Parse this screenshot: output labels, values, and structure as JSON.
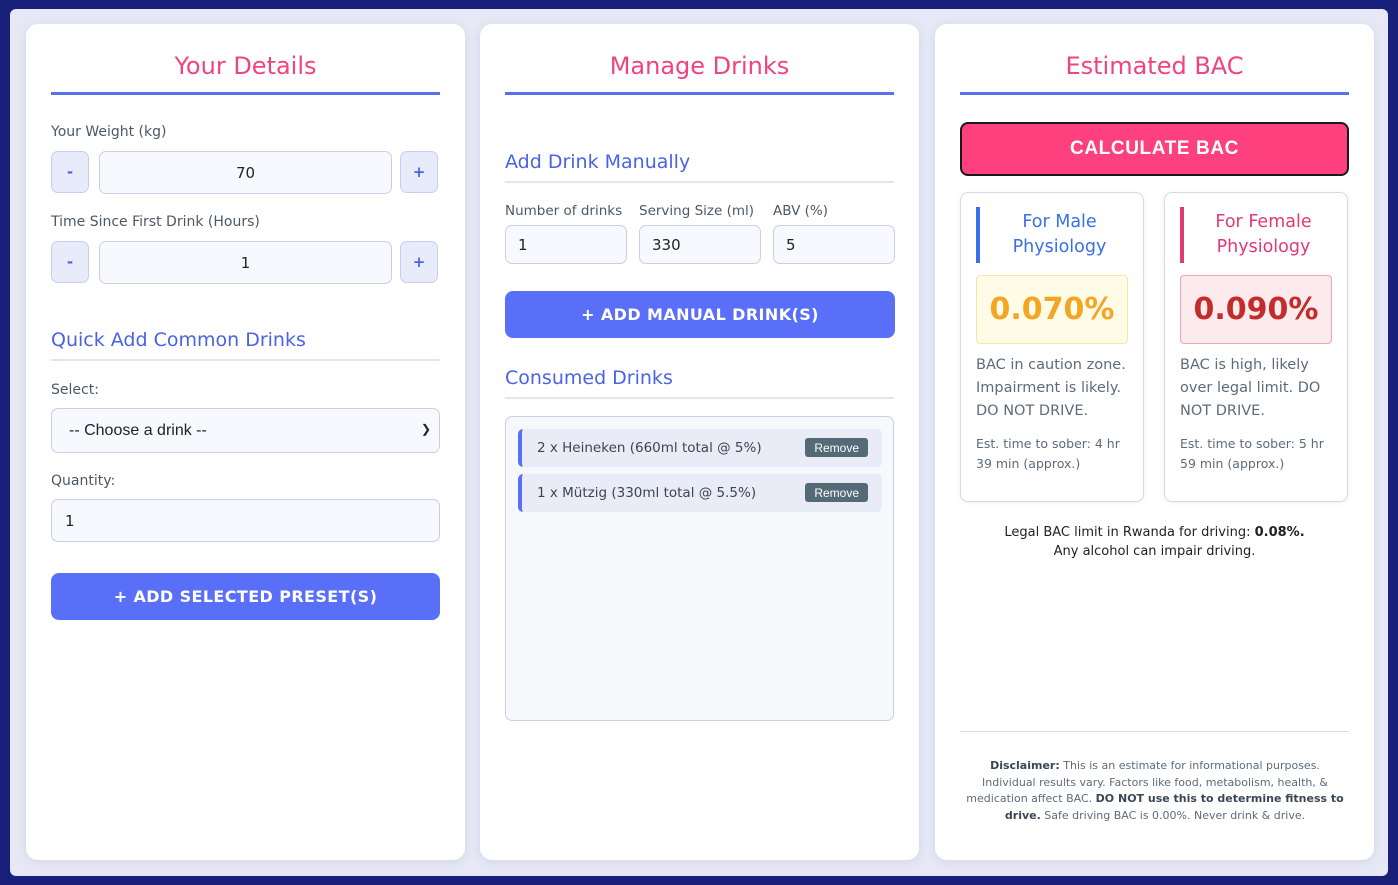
{
  "details": {
    "title": "Your Details",
    "weight_label": "Your Weight (kg)",
    "weight_value": "70",
    "time_label": "Time Since First Drink (Hours)",
    "time_value": "1",
    "minus": "-",
    "plus": "+",
    "quick_title": "Quick Add Common Drinks",
    "select_label": "Select:",
    "select_value": "-- Choose a drink --",
    "quantity_label": "Quantity:",
    "quantity_value": "1",
    "add_preset_button": "+ ADD SELECTED PRESET(S)"
  },
  "drinks": {
    "title": "Manage Drinks",
    "manual_title": "Add Drink Manually",
    "count_label": "Number of drinks",
    "count_value": "1",
    "size_label": "Serving Size (ml)",
    "size_value": "330",
    "abv_label": "ABV (%)",
    "abv_value": "5",
    "add_manual_button": "+ ADD MANUAL DRINK(S)",
    "consumed_title": "Consumed Drinks",
    "consumed": [
      {
        "text": "2 x Heineken (660ml total @ 5%)",
        "remove": "Remove"
      },
      {
        "text": "1 x Mützig (330ml total @ 5.5%)",
        "remove": "Remove"
      }
    ]
  },
  "bac": {
    "title": "Estimated BAC",
    "calc_button": "CALCULATE BAC",
    "male": {
      "title": "For Male Physiology",
      "value": "0.070%",
      "status": "BAC in caution zone. Impairment is likely. DO NOT DRIVE.",
      "sober": "Est. time to sober: 4 hr 39 min (approx.)"
    },
    "female": {
      "title": "For Female Physiology",
      "value": "0.090%",
      "status": "BAC is high, likely over legal limit. DO NOT DRIVE.",
      "sober": "Est. time to sober: 5 hr 59 min (approx.)"
    },
    "legal_prefix": "Legal BAC limit in Rwanda for driving: ",
    "legal_value": "0.08%.",
    "legal_note": "Any alcohol can impair driving.",
    "disclaimer_label": "Disclaimer:",
    "disclaimer_1": " This is an estimate for informational purposes. Individual results vary. Factors like food, metabolism, health, & medication affect BAC. ",
    "disclaimer_bold": "DO NOT use this to determine fitness to drive.",
    "disclaimer_2": " Safe driving BAC is 0.00%. Never drink & drive."
  },
  "colors": {
    "background": "#18207a",
    "accent": "#5a6ff7",
    "title_pink": "#f0447f",
    "male": "#3a6fe6",
    "female": "#e13a72"
  }
}
